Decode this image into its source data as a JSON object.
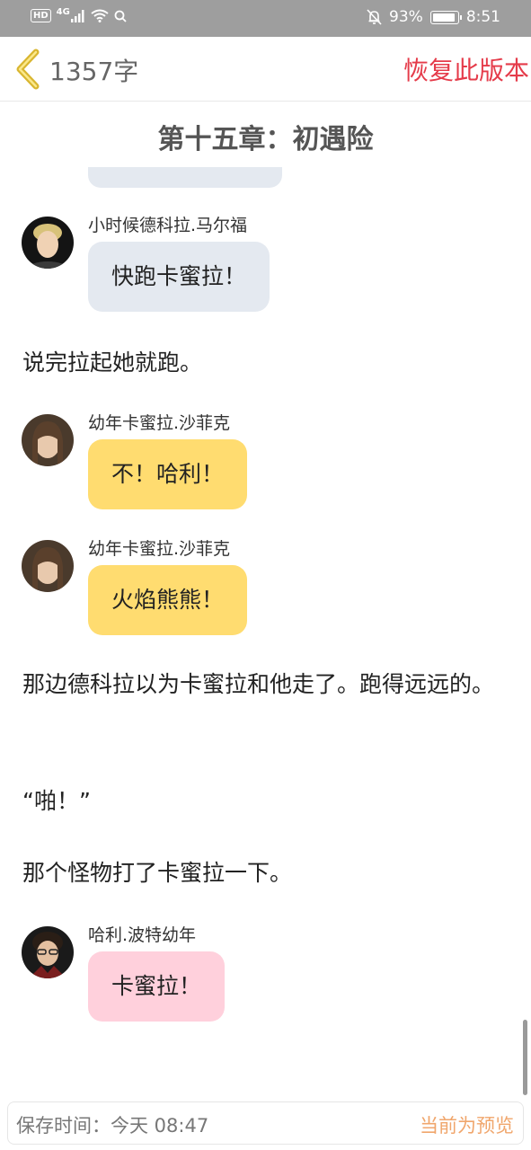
{
  "status_bar": {
    "hd": "HD",
    "network": "4G",
    "battery_text": "93%",
    "battery_level": 0.93,
    "time": "8:51"
  },
  "header": {
    "word_count": "1357字",
    "restore_label": "恢复此版本"
  },
  "chapter_title": "第十五章：初遇险",
  "messages": [
    {
      "speaker": "小时候德科拉.马尔福",
      "text": "快跑卡蜜拉！"
    },
    {
      "speaker": "幼年卡蜜拉.沙菲克",
      "text": "不！哈利！"
    },
    {
      "speaker": "幼年卡蜜拉.沙菲克",
      "text": "火焰熊熊！"
    },
    {
      "speaker": "哈利.波特幼年",
      "text": "卡蜜拉！"
    }
  ],
  "narration": [
    "说完拉起她就跑。",
    "那边德科拉以为卡蜜拉和他走了。跑得远远的。",
    "“啪！”",
    "那个怪物打了卡蜜拉一下。"
  ],
  "footer": {
    "save_time": "保存时间：今天 08:47",
    "preview_label": "当前为预览"
  },
  "colors": {
    "accent_red": "#e53b4a",
    "preview_orange": "#f0a66c",
    "bubble_gray": "#e4e9f0",
    "bubble_yellow": "#ffdc70",
    "bubble_pink": "#ffd0dc",
    "back_icon_gold": "#d9b630"
  }
}
